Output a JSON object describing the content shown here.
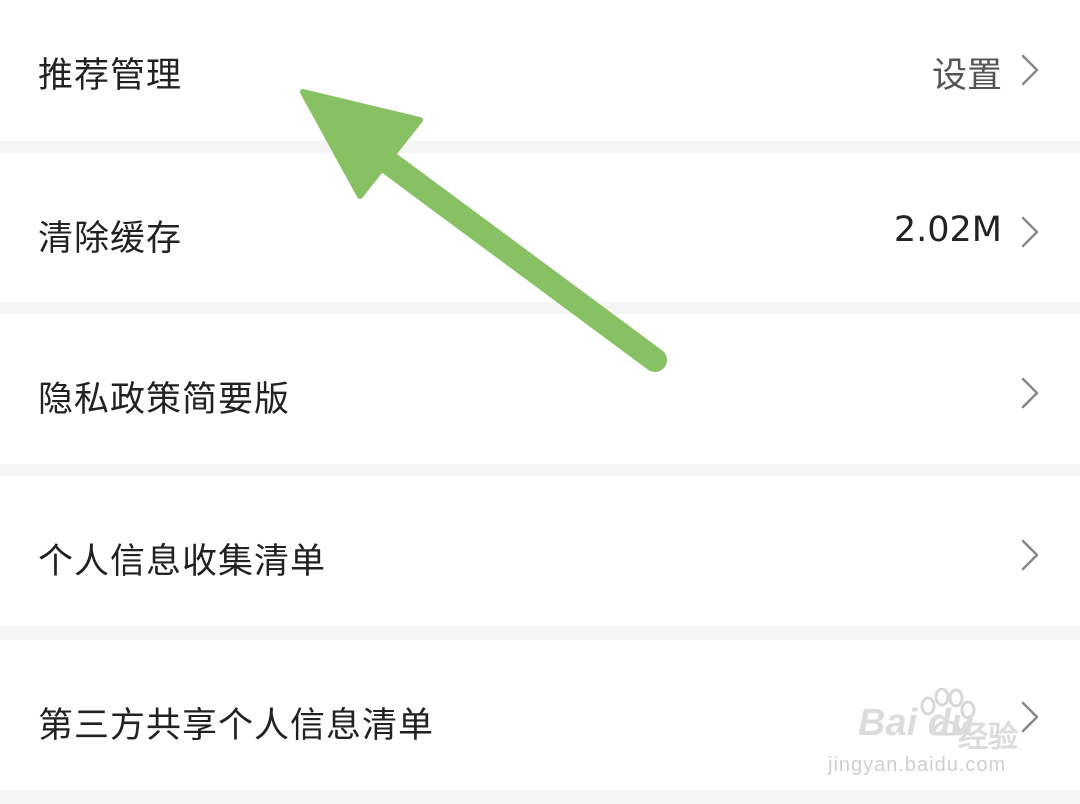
{
  "settings": {
    "items": [
      {
        "label": "推荐管理",
        "value": "设置"
      },
      {
        "label": "清除缓存",
        "value": "2.02M"
      },
      {
        "label": "隐私政策简要版",
        "value": ""
      },
      {
        "label": "个人信息收集清单",
        "value": ""
      },
      {
        "label": "第三方共享个人信息清单",
        "value": ""
      }
    ]
  },
  "icons": {
    "chevron": "chevron-right-icon",
    "annotation": "green-arrow-icon"
  },
  "colors": {
    "row_bg": "#ffffff",
    "separator_bg": "#f5f5f5",
    "label_text": "#222222",
    "value_text": "#555555",
    "chevron": "#8a8a8a",
    "arrow": "#87c163"
  },
  "watermark": {
    "brand": "Bai du",
    "sub": "经验",
    "url": "jingyan.baidu.com"
  }
}
